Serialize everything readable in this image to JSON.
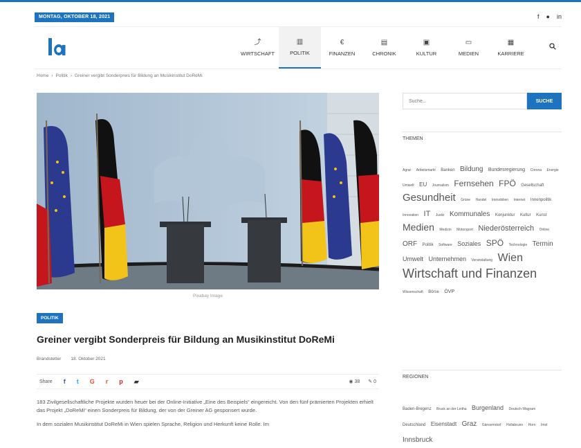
{
  "topbar": {
    "date": "MONTAG, OKTOBER 18, 2021",
    "social": [
      {
        "icon": "facebook-icon",
        "glyph": "f"
      },
      {
        "icon": "rss-icon",
        "glyph": "●"
      },
      {
        "icon": "linkedin-icon",
        "glyph": "in"
      }
    ]
  },
  "nav": {
    "items": [
      {
        "label": "WIRTSCHAFT",
        "icon": "chart-icon",
        "glyph": "⤴"
      },
      {
        "label": "POLITIK",
        "icon": "building-icon",
        "glyph": "▥"
      },
      {
        "label": "FINANZEN",
        "icon": "euro-icon",
        "glyph": "€"
      },
      {
        "label": "CHRONIK",
        "icon": "calendar-icon",
        "glyph": "▤"
      },
      {
        "label": "KULTUR",
        "icon": "image-icon",
        "glyph": "▣"
      },
      {
        "label": "MEDIEN",
        "icon": "monitor-icon",
        "glyph": "▭"
      },
      {
        "label": "KARRIERE",
        "icon": "briefcase-icon",
        "glyph": "▦"
      }
    ],
    "active": 1
  },
  "breadcrumb": [
    "Home",
    "›",
    "Politik",
    "›",
    "Greiner vergibt Sonderpreis für Bildung an Musikinstitut DoReMi"
  ],
  "article": {
    "caption": "Pixabay Image",
    "category": "POLITIK",
    "title": "Greiner vergibt Sonderpreis für Bildung an Musikinstitut DoReMi",
    "author": "Brandstetter",
    "date": "18. Oktober 2021",
    "share_label": "Share",
    "views": "38",
    "comments": "0",
    "paragraphs": [
      "183 Zivilgesellschaftliche Projekte wurden heuer bei der Online-Initiative „Eine des Beispiels“ eingereicht. Von den fünf prämierten Projekten erhielt das Projekt „DoReMi“ einen Sonderpreis für Bildung, der von der Greiner AG gesponsert wurde.",
      "In dem sozialen Musikinstitut DoReMi in Wien spielen Sprache, Religion und Herkunft keine Rolle. Im"
    ]
  },
  "sidebar": {
    "search_placeholder": "Suche...",
    "search_button": "SUCHE",
    "themen_title": "THEMEN",
    "regionen_title": "REGIONEN",
    "tags": [
      {
        "t": "Agrar",
        "s": 5
      },
      {
        "t": "Arbeitsmarkt",
        "s": 5
      },
      {
        "t": "Banken",
        "s": 6
      },
      {
        "t": "Bildung",
        "s": 10
      },
      {
        "t": "Bundesregierung",
        "s": 7
      },
      {
        "t": "Corona",
        "s": 5
      },
      {
        "t": "Energie",
        "s": 5
      },
      {
        "t": "Umwelt",
        "s": 5
      },
      {
        "t": "EU",
        "s": 8
      },
      {
        "t": "Journalism",
        "s": 5
      },
      {
        "t": "Fernsehen",
        "s": 12
      },
      {
        "t": "FPÖ",
        "s": 12
      },
      {
        "t": "Gesellschaft",
        "s": 6
      },
      {
        "t": "Gesundheit",
        "s": 15
      },
      {
        "t": "Grüne",
        "s": 5
      },
      {
        "t": "Handel",
        "s": 5
      },
      {
        "t": "Immobilien",
        "s": 5
      },
      {
        "t": "Internet",
        "s": 5
      },
      {
        "t": "Innenpolitik",
        "s": 6
      },
      {
        "t": "Innovation",
        "s": 5
      },
      {
        "t": "IT",
        "s": 11
      },
      {
        "t": "Justiz",
        "s": 5
      },
      {
        "t": "Kommunales",
        "s": 10
      },
      {
        "t": "Konjunktur",
        "s": 6
      },
      {
        "t": "Kultur",
        "s": 6
      },
      {
        "t": "Kunst",
        "s": 6
      },
      {
        "t": "Medien",
        "s": 14
      },
      {
        "t": "Medizin",
        "s": 5
      },
      {
        "t": "Motorsport",
        "s": 5
      },
      {
        "t": "Niederösterreich",
        "s": 11
      },
      {
        "t": "Online",
        "s": 5
      },
      {
        "t": "ORF",
        "s": 10
      },
      {
        "t": "Politik",
        "s": 6
      },
      {
        "t": "Software",
        "s": 5
      },
      {
        "t": "Soziales",
        "s": 9
      },
      {
        "t": "SPÖ",
        "s": 12
      },
      {
        "t": "Technologie",
        "s": 5
      },
      {
        "t": "Termin",
        "s": 10
      },
      {
        "t": "Umwelt",
        "s": 9
      },
      {
        "t": "Unternehmen",
        "s": 9
      },
      {
        "t": "Veranstaltung",
        "s": 5
      },
      {
        "t": "Wien",
        "s": 16
      },
      {
        "t": "Wirtschaft und Finanzen",
        "s": 18
      },
      {
        "t": "Wissenschaft",
        "s": 5
      },
      {
        "t": "Börse",
        "s": 6
      },
      {
        "t": "ÖVP",
        "s": 7
      }
    ],
    "regions": [
      {
        "t": "Baden-Bregenz",
        "s": 6
      },
      {
        "t": "Bruck an der Leitha",
        "s": 5
      },
      {
        "t": "Burgenland",
        "s": 9
      },
      {
        "t": "Deutsch-Wagram",
        "s": 5
      },
      {
        "t": "Deutschland",
        "s": 6
      },
      {
        "t": "Eisenstadt",
        "s": 8
      },
      {
        "t": "Graz",
        "s": 10
      },
      {
        "t": "Gänserndorf",
        "s": 5
      },
      {
        "t": "Hollabrunn",
        "s": 5
      },
      {
        "t": "Horn",
        "s": 5
      },
      {
        "t": "Imst",
        "s": 5
      },
      {
        "t": "Innsbruck",
        "s": 10
      }
    ]
  }
}
